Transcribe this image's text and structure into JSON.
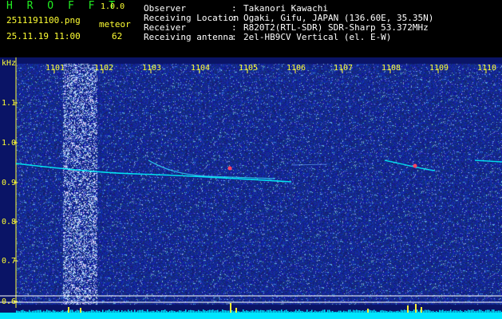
{
  "header": {
    "app_name": "H R O F F T",
    "app_version": "1.0.0",
    "file_name": "2511191100.png",
    "date_time": "25.11.19 11:00",
    "meteor_label": "meteor",
    "meteor_count": "62"
  },
  "info": [
    {
      "label": "Observer",
      "value": "Takanori Kawachi"
    },
    {
      "label": "Receiving Location",
      "value": "Ogaki, Gifu, JAPAN (136.60E, 35.35N)"
    },
    {
      "label": "Receiver",
      "value": "R820T2(RTL-SDR) SDR-Sharp 53.372MHz"
    },
    {
      "label": "Receiving antenna",
      "value": "2el-HB9CV Vertical (el. E-W)"
    }
  ],
  "colon": ":",
  "axis": {
    "y_unit": "kHz",
    "y_ticks": [
      "1.1",
      "1.0",
      "0.9",
      "0.8",
      "0.7",
      "0.6"
    ],
    "x_ticks": [
      "1101",
      "1102",
      "1103",
      "1104",
      "1105",
      "1106",
      "1107",
      "1108",
      "1109",
      "1110"
    ]
  },
  "colors": {
    "header_yellow": "#ffff33",
    "header_green": "#22ee22",
    "spectrogram_bg": "#0a1466",
    "echo_cyan": "#00ffff",
    "activity_bar": "#00e5ff"
  }
}
